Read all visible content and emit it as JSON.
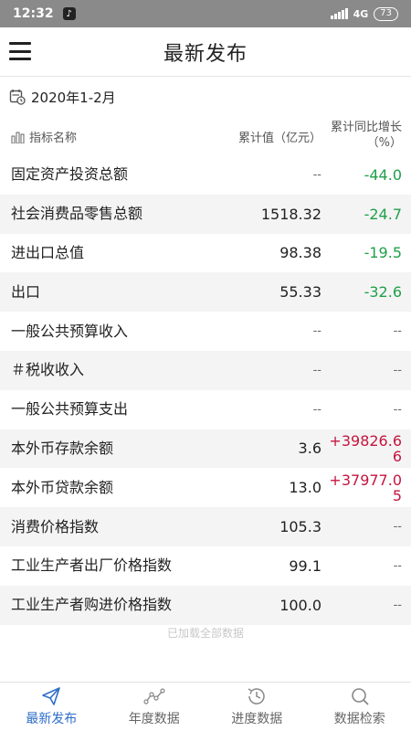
{
  "status_bar": {
    "time": "12:32",
    "network": "4G",
    "battery": "73"
  },
  "header": {
    "title": "最新发布"
  },
  "period": {
    "label": "2020年1-2月"
  },
  "table_header": {
    "name": "指标名称",
    "value": "累计值（亿元）",
    "yoy": "累计同比增长（%）"
  },
  "rows": [
    {
      "name": "固定资产投资总额",
      "value": "--",
      "yoy": "-44.0"
    },
    {
      "name": "社会消费品零售总额",
      "value": "1518.32",
      "yoy": "-24.7"
    },
    {
      "name": "进出口总值",
      "value": "98.38",
      "yoy": "-19.5"
    },
    {
      "name": "出口",
      "value": "55.33",
      "yoy": "-32.6"
    },
    {
      "name": "一般公共预算收入",
      "value": "--",
      "yoy": "--"
    },
    {
      "name": "＃税收收入",
      "value": "--",
      "yoy": "--"
    },
    {
      "name": "一般公共预算支出",
      "value": "--",
      "yoy": "--"
    },
    {
      "name": "本外币存款余额",
      "value": "3.6",
      "yoy": "+39826.66"
    },
    {
      "name": "本外币贷款余额",
      "value": "13.0",
      "yoy": "+37977.05"
    },
    {
      "name": "消费价格指数",
      "value": "105.3",
      "yoy": "--"
    },
    {
      "name": "工业生产者出厂价格指数",
      "value": "99.1",
      "yoy": "--"
    },
    {
      "name": "工业生产者购进价格指数",
      "value": "100.0",
      "yoy": "--"
    }
  ],
  "footer_tip": "已加载全部数据",
  "nav": [
    {
      "label": "最新发布",
      "icon": "send-icon",
      "active": true
    },
    {
      "label": "年度数据",
      "icon": "trend-icon",
      "active": false
    },
    {
      "label": "进度数据",
      "icon": "history-icon",
      "active": false
    },
    {
      "label": "数据检索",
      "icon": "search-icon",
      "active": false
    }
  ],
  "colors": {
    "accent": "#2f6fc8",
    "negative": "#1fa048",
    "positive": "#c4163f",
    "status_bar": "#8a8a8a"
  }
}
